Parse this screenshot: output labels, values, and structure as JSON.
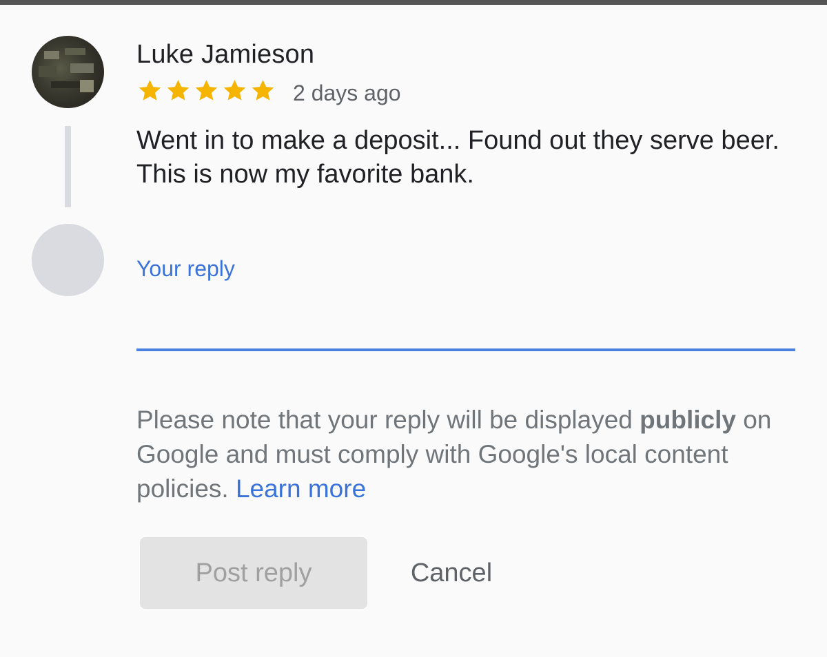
{
  "review": {
    "author_name": "Luke Jamieson",
    "rating": 5,
    "rating_max": 5,
    "time_ago": "2 days ago",
    "text": "Went in to make a deposit... Found out they serve beer. This is now my favorite bank."
  },
  "reply": {
    "label": "Your reply",
    "value": "",
    "note_before": "Please note that your reply will be displayed ",
    "note_bold": "publicly",
    "note_after": " on Google and must comply with Google's local content policies. ",
    "learn_more": "Learn more"
  },
  "actions": {
    "post_label": "Post reply",
    "cancel_label": "Cancel"
  },
  "colors": {
    "star": "#f4b400",
    "accent": "#3a73d9",
    "underline": "#4a80e0",
    "top_bar": "#555555"
  },
  "icons": {
    "star": "star-icon"
  }
}
